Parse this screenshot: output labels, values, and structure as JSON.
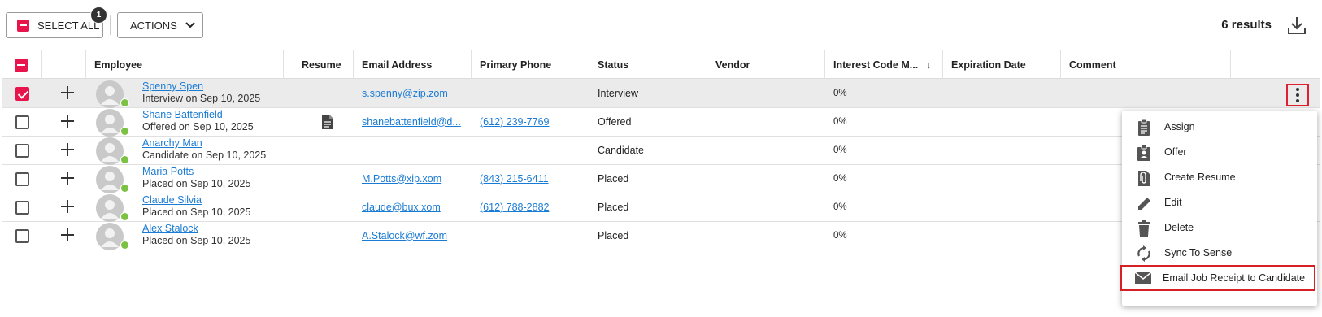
{
  "toolbar": {
    "select_all_label": "SELECT ALL",
    "selected_count": "1",
    "actions_label": "ACTIONS",
    "results_text": "6 results"
  },
  "columns": [
    "Employee",
    "Resume",
    "Email Address",
    "Primary Phone",
    "Status",
    "Vendor",
    "Interest Code M...",
    "Expiration Date",
    "Comment"
  ],
  "rows": [
    {
      "name": "Spenny Spen",
      "sub": "Interview on Sep 10, 2025",
      "email": "s.spenny@zip.zom",
      "phone": "",
      "status": "Interview",
      "interest": "0%",
      "selected": true
    },
    {
      "name": "Shane Battenfield",
      "sub": "Offered on Sep 10, 2025",
      "email": "shanebattenfield@d...",
      "phone": "(612) 239-7769",
      "status": "Offered",
      "interest": "0%",
      "resume": true
    },
    {
      "name": "Anarchy Man",
      "sub": "Candidate on Sep 10, 2025",
      "email": "",
      "phone": "",
      "status": "Candidate",
      "interest": "0%"
    },
    {
      "name": "Maria Potts",
      "sub": "Placed on Sep 10, 2025",
      "email": "M.Potts@xip.xom",
      "phone": "(843) 215-6411",
      "status": "Placed",
      "interest": "0%"
    },
    {
      "name": "Claude Silvia",
      "sub": "Placed on Sep 10, 2025",
      "email": "claude@bux.xom",
      "phone": "(612) 788-2882",
      "status": "Placed",
      "interest": "0%"
    },
    {
      "name": "Alex Stalock",
      "sub": "Placed on Sep 10, 2025",
      "email": "A.Stalock@wf.zom",
      "phone": "",
      "status": "Placed",
      "interest": "0%"
    }
  ],
  "menu": {
    "items": [
      {
        "label": "Assign",
        "icon": "clipboard-icon"
      },
      {
        "label": "Offer",
        "icon": "badge-icon"
      },
      {
        "label": "Create Resume",
        "icon": "attachment-icon"
      },
      {
        "label": "Edit",
        "icon": "pencil-icon"
      },
      {
        "label": "Delete",
        "icon": "trash-icon"
      },
      {
        "label": "Sync To Sense",
        "icon": "sync-icon"
      },
      {
        "label": "Email Job Receipt to Candidate",
        "icon": "envelope-icon",
        "highlighted": true
      }
    ]
  },
  "colors": {
    "accent": "#e8154d",
    "link": "#1a7bd4",
    "online": "#7bc142",
    "highlight_border": "#d71f26"
  }
}
